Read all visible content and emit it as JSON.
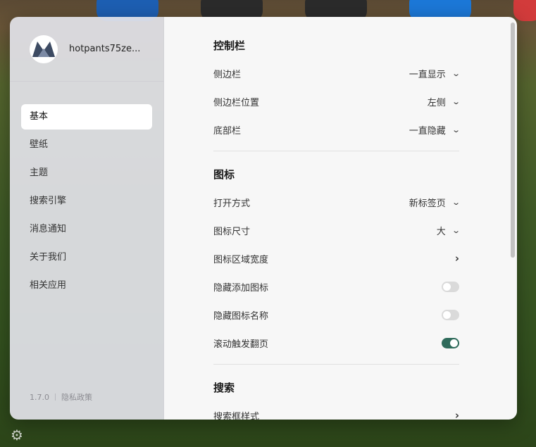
{
  "account": {
    "username": "hotpants75ze..."
  },
  "sidebar": {
    "items": [
      {
        "label": "基本",
        "active": true
      },
      {
        "label": "壁纸",
        "active": false
      },
      {
        "label": "主题",
        "active": false
      },
      {
        "label": "搜索引擎",
        "active": false
      },
      {
        "label": "消息通知",
        "active": false
      },
      {
        "label": "关于我们",
        "active": false
      },
      {
        "label": "相关应用",
        "active": false
      }
    ],
    "version": "1.7.0",
    "privacy_label": "隐私政策"
  },
  "sections": {
    "control_bar": {
      "title": "控制栏",
      "sidebar_label": "侧边栏",
      "sidebar_value": "一直显示",
      "sidebar_position_label": "侧边栏位置",
      "sidebar_position_value": "左侧",
      "bottom_bar_label": "底部栏",
      "bottom_bar_value": "一直隐藏"
    },
    "icons": {
      "title": "图标",
      "open_mode_label": "打开方式",
      "open_mode_value": "新标签页",
      "icon_size_label": "图标尺寸",
      "icon_size_value": "大",
      "icon_area_width_label": "图标区域宽度",
      "hide_add_icon_label": "隐藏添加图标",
      "hide_add_icon_on": false,
      "hide_icon_name_label": "隐藏图标名称",
      "hide_icon_name_on": false,
      "scroll_page_label": "滚动触发翻页",
      "scroll_page_on": true
    },
    "search": {
      "title": "搜索",
      "search_box_style_label": "搜索框样式"
    }
  },
  "colors": {
    "toggle_on": "#2f6b5b",
    "toggle_off": "#dadada",
    "active_menu_bg": "#ffffff"
  }
}
